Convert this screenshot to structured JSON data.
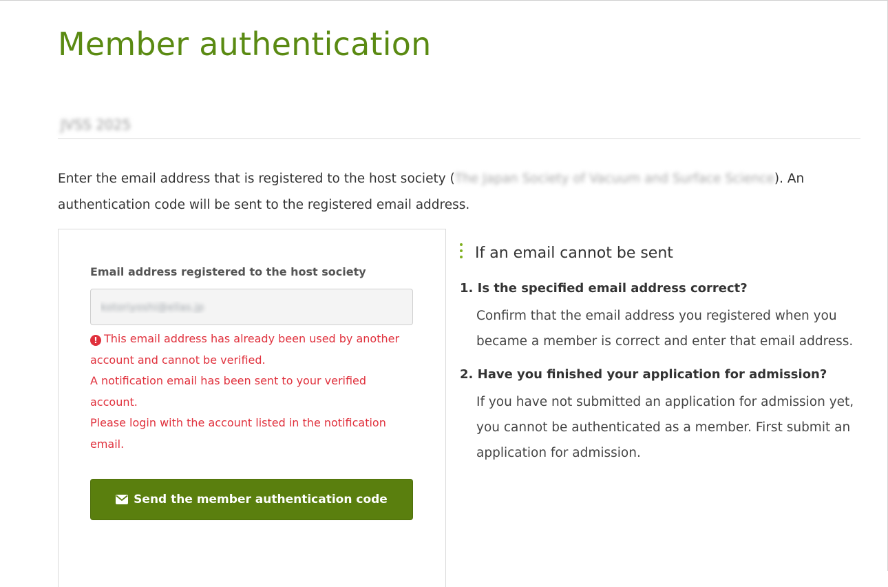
{
  "page": {
    "title": "Member authentication",
    "event_name": "JVSS 2025"
  },
  "intro": {
    "text_before": "Enter the email address that is registered to the host society (",
    "society_name": "The Japan Society of Vacuum and Surface Science",
    "text_after": "). An authentication code will be sent to the registered email address."
  },
  "form": {
    "email_label": "Email address registered to the host society",
    "email_value": "kotoriyoshi@ellas.jp",
    "error_lines": [
      "This email address has already been used by another account and cannot be verified.",
      "A notification email has been sent to your verified account.",
      "Please login with the account listed in the notification email."
    ],
    "send_button_label": "Send the member authentication code"
  },
  "help": {
    "heading": "If an email cannot be sent",
    "items": [
      {
        "title": "1. Is the specified email address correct?",
        "body": "Confirm that the email address you registered when you became a member is correct and enter that email address."
      },
      {
        "title": "2. Have you finished your application for admission?",
        "body": "If you have not submitted an application for admission yet, you cannot be authenticated as a member. First submit an application for admission."
      }
    ]
  },
  "colors": {
    "title_green": "#5a8a12",
    "button_green": "#5a7f0e",
    "error_red": "#e0303c"
  },
  "icons": {
    "error": "exclamation-circle-icon",
    "button": "envelope-icon",
    "heading": "dotted-bar-icon"
  }
}
